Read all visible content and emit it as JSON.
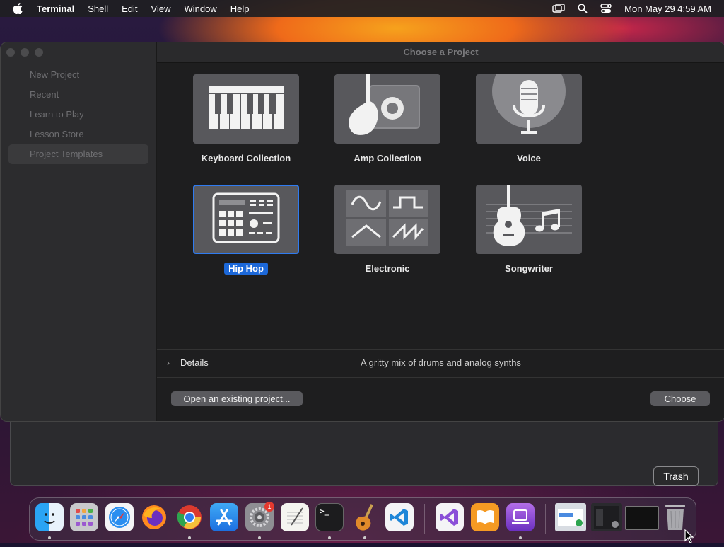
{
  "menubar": {
    "app": "Terminal",
    "items": [
      "Shell",
      "Edit",
      "View",
      "Window",
      "Help"
    ],
    "clock": "Mon May 29  4:59 AM",
    "icons": [
      "screen-mirroring-icon",
      "search-icon",
      "control-center-icon"
    ]
  },
  "dialog": {
    "title": "Choose a Project",
    "sidebar": [
      "New Project",
      "Recent",
      "Learn to Play",
      "Lesson Store",
      "Project Templates"
    ],
    "selected_sidebar": "Project Templates",
    "templates": [
      {
        "label": "Keyboard Collection",
        "icon": "piano-keys-icon"
      },
      {
        "label": "Amp Collection",
        "icon": "guitar-amp-icon"
      },
      {
        "label": "Voice",
        "icon": "microphone-icon"
      },
      {
        "label": "Hip Hop",
        "icon": "drum-machine-icon",
        "selected": true
      },
      {
        "label": "Electronic",
        "icon": "waveforms-icon"
      },
      {
        "label": "Songwriter",
        "icon": "acoustic-guitar-icon"
      }
    ],
    "details": {
      "label": "Details",
      "description": "A gritty mix of drums and analog synths"
    },
    "open_button": "Open an existing project...",
    "choose_button": "Choose"
  },
  "dock": {
    "apps": [
      "Finder",
      "Launchpad",
      "Safari",
      "Firefox",
      "Chrome",
      "App Store",
      "System Settings",
      "TextEdit",
      "Terminal",
      "GarageBand",
      "VS Code",
      "Visual Studio",
      "Books",
      "Podcasts Creator"
    ],
    "settings_badge": "1",
    "tooltip": "Trash",
    "colors": {
      "accent": "#1c68d9"
    }
  }
}
